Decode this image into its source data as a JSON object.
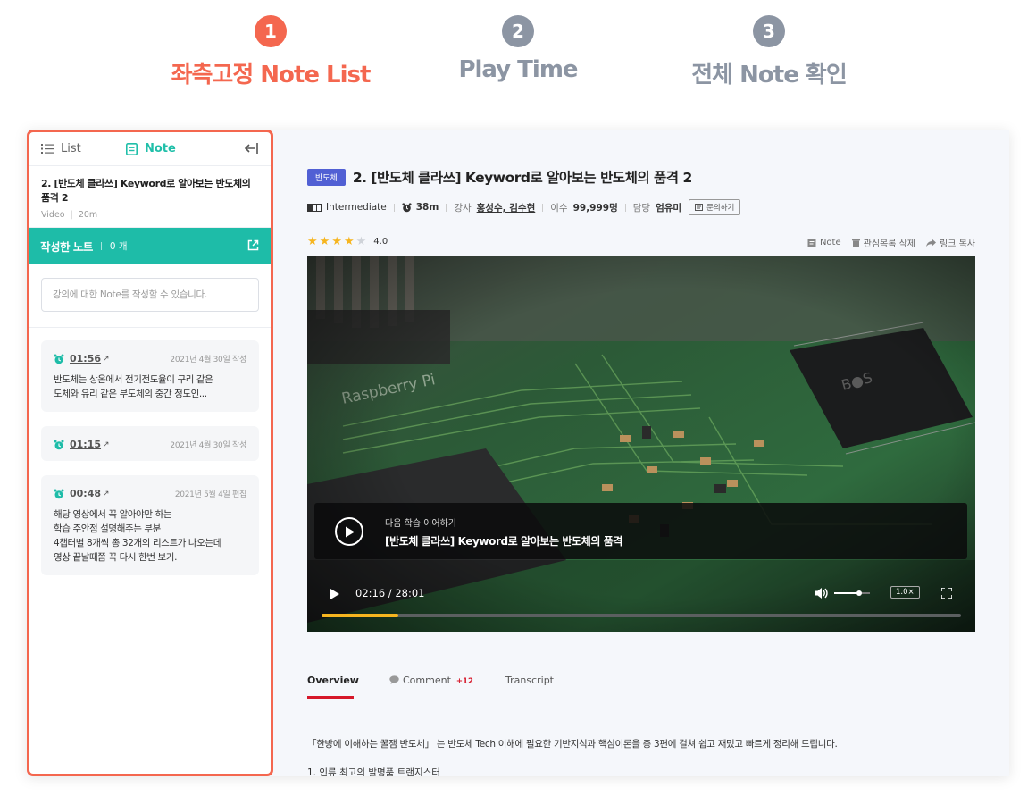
{
  "steps": [
    {
      "num": "1",
      "label": "좌측고정 Note List"
    },
    {
      "num": "2",
      "label": "Play Time"
    },
    {
      "num": "3",
      "label": "전체 Note 확인"
    }
  ],
  "colors": {
    "accent": "#f4674f",
    "teal": "#1ebca8",
    "badge": "#5160d4",
    "inactive": "#8c95a3",
    "progress": "#f6b51f",
    "red": "#d6182a"
  },
  "panel": {
    "tab_list": "List",
    "tab_note": "Note",
    "lecture_title": "2. [반도체 클라쓰] Keyword로 알아보는 반도체의 품격 2",
    "lecture_type": "Video",
    "lecture_duration": "20m",
    "notes_bar_title": "작성한 노트",
    "notes_bar_count": "0 개",
    "input_placeholder": "강의에 대한 Note를 작성할 수 있습니다.",
    "notes": [
      {
        "time": "01:56",
        "date": "2021년 4월 30일 작성",
        "text": [
          "반도체는 상온에서 전기전도율이 구리 같은",
          "도체와 유리 같은 부도체의  중간 정도인..."
        ]
      },
      {
        "time": "01:15",
        "date": "2021년 4월 30일 작성",
        "text": []
      },
      {
        "time": "00:48",
        "date": "2021년 5월 4일 편집",
        "text": [
          "해당 영상에서 꼭 알아야만 하는",
          "학습 주안점 설명해주는 부분",
          "4챕터별 8개씩 총 32개의 리스트가 나오는데",
          "영상 끝날때쯤 꼭 다시 한번 보기."
        ]
      }
    ]
  },
  "main": {
    "badge": "반도체",
    "title": "2. [반도체 클라쓰] Keyword로 알아보는 반도체의 품격 2",
    "level": "Intermediate",
    "duration": "38m",
    "instructor_label": "강사",
    "instructors": "홍성수, 김수현",
    "completion_label": "이수",
    "completion_count": "99,999명",
    "manager_label": "담당",
    "manager": "엄유미",
    "inquiry_label": "문의하기",
    "rating": 4.0,
    "rating_text": "4.0",
    "action_note": "Note",
    "action_remove": "관심목록 삭제",
    "action_link": "링크 복사"
  },
  "player": {
    "next_subtitle": "다음 학습 이어하기",
    "next_title": "[반도체 클라쓰] Keyword로 알아보는 반도체의 품격",
    "time": "02:16 / 28:01",
    "speed": "1.0×",
    "progress": 0.12,
    "volume": 0.7
  },
  "tabs": {
    "overview": "Overview",
    "comment": "Comment",
    "comment_count": "+12",
    "transcript": "Transcript"
  },
  "description": {
    "line1": "「한방에 이해하는 꿀잼 반도체」 는 반도체 Tech 이해에 필요한 기반지식과 핵심이론을 총 3편에 걸쳐 쉽고 재밌고 빠르게 정리해 드립니다.",
    "line2": "1. 인류 최고의 발명품 트랜지스터"
  }
}
